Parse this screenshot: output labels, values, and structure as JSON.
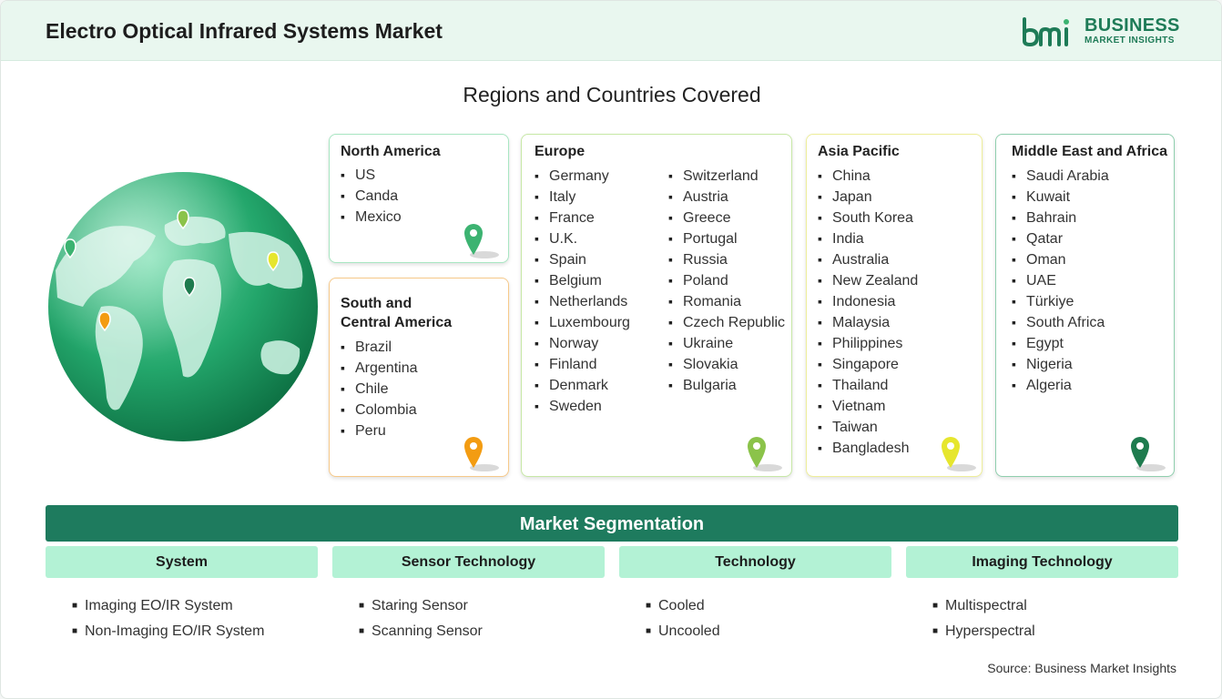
{
  "header": {
    "title": "Electro Optical Infrared Systems Market"
  },
  "logo": {
    "brand_top": "BUSINESS",
    "brand_bottom": "MARKET INSIGHTS",
    "icon": "bmi-logo-icon"
  },
  "section_title": "Regions and Countries Covered",
  "regions": {
    "north_america": {
      "title": "North America",
      "countries": [
        "US",
        "Canda",
        "Mexico"
      ],
      "color": "#3cb371"
    },
    "south_central_america": {
      "title_line1": "South and",
      "title_line2": "Central America",
      "countries": [
        "Brazil",
        "Argentina",
        "Chile",
        "Colombia",
        "Peru"
      ],
      "color": "#f39c12"
    },
    "europe": {
      "title": "Europe",
      "countries_col1": [
        "Germany",
        "Italy",
        "France",
        "U.K.",
        "Spain",
        "Belgium",
        "Netherlands",
        "Luxembourg",
        "Norway",
        "Finland",
        "Denmark",
        "Sweden"
      ],
      "countries_col2": [
        "Switzerland",
        "Austria",
        "Greece",
        "Portugal",
        "Russia",
        "Poland",
        "Romania",
        "Czech Republic",
        "Ukraine",
        "Slovakia",
        "Bulgaria"
      ],
      "color": "#8bc34a"
    },
    "asia_pacific": {
      "title": "Asia Pacific",
      "countries": [
        "China",
        "Japan",
        "South Korea",
        "India",
        "Australia",
        "New Zealand",
        "Indonesia",
        "Malaysia",
        "Philippines",
        "Singapore",
        "Thailand",
        "Vietnam",
        "Taiwan",
        "Bangladesh"
      ],
      "color": "#e6e62e"
    },
    "middle_east_africa": {
      "title": "Middle East and Africa",
      "countries": [
        "Saudi Arabia",
        "Kuwait",
        "Bahrain",
        "Qatar",
        "Oman",
        "UAE",
        "Türkiye",
        "South Africa",
        "Egypt",
        "Nigeria",
        "Algeria"
      ],
      "color": "#1e7b4e"
    }
  },
  "segmentation": {
    "title": "Market Segmentation",
    "segments": [
      {
        "name": "System",
        "items": [
          "Imaging EO/IR System",
          "Non-Imaging EO/IR System"
        ]
      },
      {
        "name": "Sensor Technology",
        "items": [
          "Staring Sensor",
          "Scanning Sensor"
        ]
      },
      {
        "name": "Technology",
        "items": [
          "Cooled",
          "Uncooled"
        ]
      },
      {
        "name": "Imaging Technology",
        "items": [
          "Multispectral",
          "Hyperspectral"
        ]
      }
    ]
  },
  "source": "Source: Business Market Insights",
  "colors": {
    "primary": "#1e7b5e",
    "header_bg": "#e9f7ef",
    "segment_head_bg": "#b3f2d5"
  }
}
